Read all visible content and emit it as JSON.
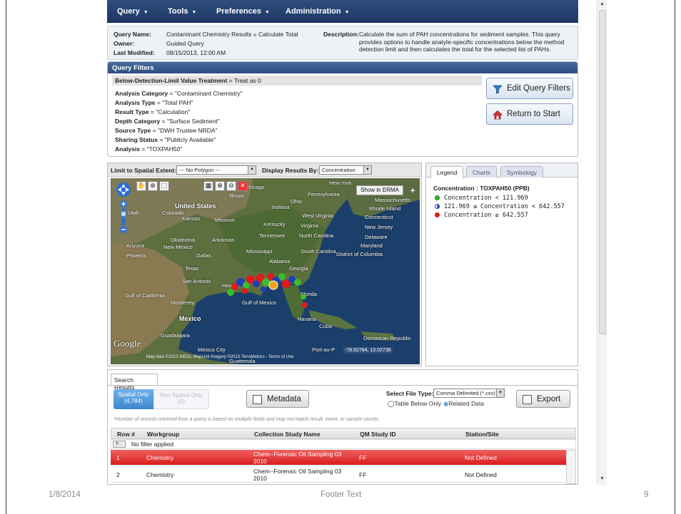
{
  "menu": {
    "items": [
      "Query",
      "Tools",
      "Preferences",
      "Administration"
    ]
  },
  "query_info": {
    "name_label": "Query Name:",
    "name_value": "Contaminant Chemistry Results » Calculate Total",
    "owner_label": "Owner:",
    "owner_value": "Guided Query",
    "modified_label": "Last Modified:",
    "modified_value": "08/15/2013, 12:00 AM",
    "description_label": "Description:",
    "description_value": "Calculate the sum of PAH concentrations for sediment samples. This query provides options to handle analyte-specific concentrations below the method detection limit and then calculates the total for the selected list of PAHs."
  },
  "filters": {
    "header": "Query Filters",
    "bdl_label": "Below-Detection-Limit Value Treatment",
    "bdl_value": " = Treat as 0",
    "rows": [
      {
        "label": "Analysis Category",
        "value": " = \"Contaminant Chemistry\""
      },
      {
        "label": "Analysis Type",
        "value": " = \"Total PAH\""
      },
      {
        "label": "Result Type",
        "value": " = \"Calculation\""
      },
      {
        "label": "Depth Category",
        "value": " = \"Surface Sediment\""
      },
      {
        "label": "Source Type",
        "value": " = \"DWH Trustee NRDA\""
      },
      {
        "label": "Sharing Status",
        "value": " = \"Publicly Available\""
      },
      {
        "label": "Analysis",
        "value": " = \"TOXPAH50\""
      }
    ],
    "edit_button": "Edit Query Filters",
    "return_button": "Return to Start"
  },
  "map": {
    "spatial_label": "Limit to Spatial Extent:",
    "spatial_value": "--- No Polygon ---",
    "display_label": "Display Results By:",
    "display_value": "Concentration",
    "erma_button": "Show in ERMA",
    "place_labels": [
      "United States",
      "Mexico",
      "Gulf of Mexico",
      "Gulf of California",
      "Cuba",
      "Havana",
      "Dominican Republic",
      "Port-au-P",
      "Chicago",
      "New York",
      "Illinois",
      "Indiana",
      "Ohio",
      "Pennsylvania",
      "Massachusetts",
      "Rhode Island",
      "Connecticut",
      "New Jersey",
      "Delaware",
      "Maryland",
      "District of Columbia",
      "West Virginia",
      "Virginia",
      "Kentucky",
      "Tennessee",
      "North Carolina",
      "South Carolina",
      "Georgia",
      "Alabama",
      "Mississippi",
      "Florida",
      "Arkansas",
      "Oklahoma",
      "Kansas",
      "Missouri",
      "Texas",
      "Dallas",
      "San Antonio",
      "Houston",
      "Monterrey",
      "Guadalajara",
      "Mexico City",
      "Colorado",
      "Utah",
      "Arizona",
      "New Mexico",
      "Phoenix",
      "Guatemala"
    ],
    "google": "Google",
    "copyright": "Map data ©2013 INEGI, MapLink Imagery ©2013 TerraMetrics - Terms of Use",
    "coords": "-78.92784, 13.02736"
  },
  "legend": {
    "tabs": [
      "Legend",
      "Charts",
      "Symbology"
    ],
    "title": "Concentration : TOXPAH50 (PPB)",
    "items": [
      {
        "text": "Concentration < 121.969",
        "color": "#3dbb2e"
      },
      {
        "text": "121.969 ≤ Concentration < 642.557",
        "color": "#1f3fb5"
      },
      {
        "text": "Concentration ≥ 642.557",
        "color": "#e01b1b"
      }
    ]
  },
  "results": {
    "tab": "Search Results",
    "spatial_only": "Spatial Only",
    "spatial_count": "(4,784)",
    "non_spatial": "Non-Spatial Only",
    "non_spatial_count": "(0)",
    "metadata_button": "Metadata",
    "file_type_label": "Select File Type:",
    "file_type_value": "Comma Delimited (*.csv)",
    "radio_table": "Table Below Only",
    "radio_related": "Related Data",
    "export_button": "Export",
    "note": "*Number of records returned from a query is based on multiple fields and may not match result, event, or sample counts.",
    "columns": [
      "Row #",
      "Workgroup",
      "Collection Study Name",
      "QM Study ID",
      "Station/Site"
    ],
    "no_filter": "No filter applied",
    "rows": [
      {
        "row": "1",
        "workgroup": "Chemistry",
        "study": "Chem--Forensic Oil Sampling 03 2010",
        "qm": "FF",
        "station": "Not Defined"
      },
      {
        "row": "2",
        "workgroup": "Chemistry",
        "study": "Chem--Forensic Oil Sampling 03 2010",
        "qm": "FF",
        "station": "Not Defined"
      }
    ]
  },
  "footer": {
    "date": "1/8/2014",
    "text": "Footer Text",
    "page": "9"
  }
}
